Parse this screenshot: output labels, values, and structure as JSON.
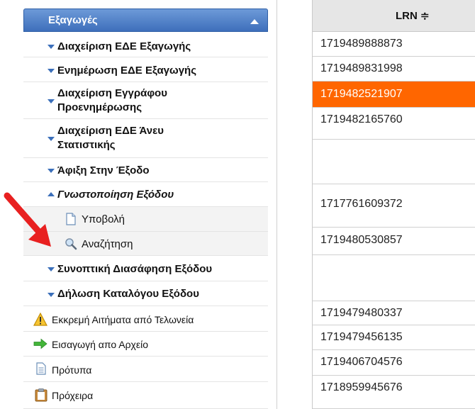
{
  "sidebar": {
    "title": "Εξαγωγές",
    "items": [
      {
        "label": "Διαχείριση ΕΔΕ Εξαγωγής"
      },
      {
        "label": "Ενημέρωση ΕΔΕ Εξαγωγής"
      },
      {
        "label": "Διαχείριση Εγγράφου Προενημέρωσης"
      },
      {
        "label": "Διαχείριση ΕΔΕ Άνευ Στατιστικής"
      },
      {
        "label": "Άφιξη Στην Έξοδο"
      },
      {
        "label": "Γνωστοποίηση Εξόδου"
      },
      {
        "label": "Υποβολή"
      },
      {
        "label": "Αναζήτηση"
      },
      {
        "label": "Συνοπτική Διασάφηση Εξόδου"
      },
      {
        "label": "Δήλωση Καταλόγου Εξόδου"
      },
      {
        "label": "Εκκρεμή Αιτήματα από Τελωνεία"
      },
      {
        "label": "Εισαγωγή απο Αρχείο"
      },
      {
        "label": "Πρότυπα"
      },
      {
        "label": "Πρόχειρα"
      }
    ]
  },
  "grid": {
    "column_header": "LRN ≑",
    "rows": [
      "1719489888873",
      "1719489831998",
      "1719482521907",
      "1719482165760",
      "",
      "1717761609372",
      "1719480530857",
      "",
      "1719479480337",
      "1719479456135",
      "1719406704576",
      "1718959945676"
    ],
    "selected_row": 2
  },
  "colors": {
    "header_blue": "#3e6fbb",
    "selected_row": "#ff6600",
    "arrow": "#e82020"
  }
}
